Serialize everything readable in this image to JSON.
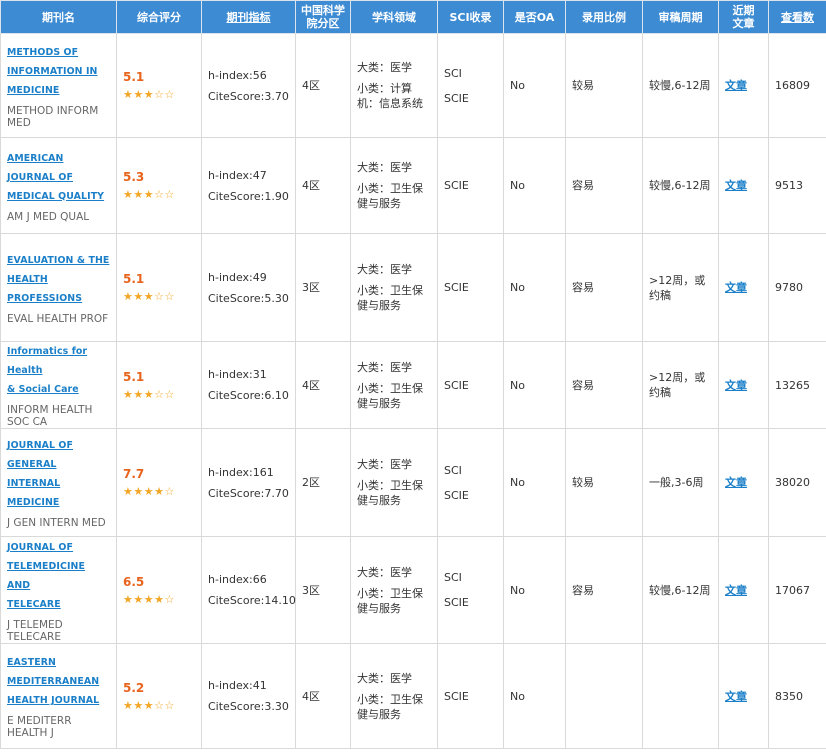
{
  "headers": {
    "name": "期刊名",
    "score": "综合评分",
    "metrics": "期刊指标",
    "zone_line1": "中国科学",
    "zone_line2": "院分区",
    "field": "学科领域",
    "sci": "SCI收录",
    "oa": "是否OA",
    "ratio": "录用比例",
    "cycle": "审稿周期",
    "recent_line1": "近期",
    "recent_line2": "文章",
    "views": "查看数"
  },
  "rows": [
    {
      "name_lines": [
        "METHODS OF",
        "INFORMATION IN",
        "MEDICINE"
      ],
      "abbr": "METHOD INFORM MED",
      "score": "5.1",
      "stars": "★★★☆☆",
      "hindex": "h-index:56",
      "citescore": "CiteScore:3.70",
      "zone": "4区",
      "major": "大类：医学",
      "minor": "小类：计算机：信息系统",
      "index": [
        "SCI",
        "SCIE"
      ],
      "oa": "No",
      "ratio": "较易",
      "cycle": "较慢,6-12周",
      "recent": "文章",
      "views": "16809"
    },
    {
      "name_lines": [
        "AMERICAN",
        "JOURNAL OF",
        "MEDICAL QUALITY"
      ],
      "abbr": "AM J MED QUAL",
      "score": "5.3",
      "stars": "★★★☆☆",
      "hindex": "h-index:47",
      "citescore": "CiteScore:1.90",
      "zone": "4区",
      "major": "大类：医学",
      "minor": "小类：卫生保健与服务",
      "index": [
        "SCIE"
      ],
      "oa": "No",
      "ratio": "容易",
      "cycle": "较慢,6-12周",
      "recent": "文章",
      "views": "9513"
    },
    {
      "name_lines": [
        "EVALUATION & THE",
        "HEALTH",
        "PROFESSIONS"
      ],
      "abbr": "EVAL HEALTH PROF",
      "score": "5.1",
      "stars": "★★★☆☆",
      "hindex": "h-index:49",
      "citescore": "CiteScore:5.30",
      "zone": "3区",
      "major": "大类：医学",
      "minor": "小类：卫生保健与服务",
      "index": [
        "SCIE"
      ],
      "oa": "No",
      "ratio": "容易",
      "cycle": ">12周，或约稿",
      "recent": "文章",
      "views": "9780"
    },
    {
      "name_lines": [
        "Informatics for Health",
        "& Social Care"
      ],
      "abbr": "INFORM HEALTH SOC CA",
      "score": "5.1",
      "stars": "★★★☆☆",
      "hindex": "h-index:31",
      "citescore": "CiteScore:6.10",
      "zone": "4区",
      "major": "大类：医学",
      "minor": "小类：卫生保健与服务",
      "index": [
        "SCIE"
      ],
      "oa": "No",
      "ratio": "容易",
      "cycle": ">12周，或约稿",
      "recent": "文章",
      "views": "13265"
    },
    {
      "name_lines": [
        "JOURNAL OF",
        "GENERAL INTERNAL",
        "MEDICINE"
      ],
      "abbr": "J GEN INTERN MED",
      "score": "7.7",
      "stars": "★★★★☆",
      "hindex": "h-index:161",
      "citescore": "CiteScore:7.70",
      "zone": "2区",
      "major": "大类：医学",
      "minor": "小类：卫生保健与服务",
      "index": [
        "SCI",
        "SCIE"
      ],
      "oa": "No",
      "ratio": "较易",
      "cycle": "一般,3-6周",
      "recent": "文章",
      "views": "38020"
    },
    {
      "name_lines": [
        "JOURNAL OF",
        "TELEMEDICINE AND",
        "TELECARE"
      ],
      "abbr": "J TELEMED TELECARE",
      "score": "6.5",
      "stars": "★★★★☆",
      "hindex": "h-index:66",
      "citescore": "CiteScore:14.10",
      "zone": "3区",
      "major": "大类：医学",
      "minor": "小类：卫生保健与服务",
      "index": [
        "SCI",
        "SCIE"
      ],
      "oa": "No",
      "ratio": "容易",
      "cycle": "较慢,6-12周",
      "recent": "文章",
      "views": "17067"
    },
    {
      "name_lines": [
        "EASTERN",
        "MEDITERRANEAN",
        "HEALTH JOURNAL"
      ],
      "abbr": "E MEDITERR HEALTH J",
      "score": "5.2",
      "stars": "★★★☆☆",
      "hindex": "h-index:41",
      "citescore": "CiteScore:3.30",
      "zone": "4区",
      "major": "大类：医学",
      "minor": "小类：卫生保健与服务",
      "index": [
        "SCIE"
      ],
      "oa": "No",
      "ratio": "",
      "cycle": "",
      "recent": "文章",
      "views": "8350"
    }
  ]
}
